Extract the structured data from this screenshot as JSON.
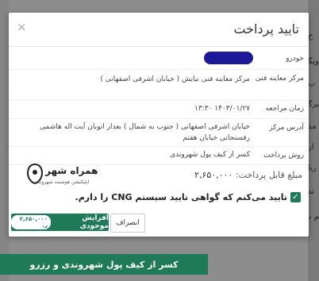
{
  "modal": {
    "title": "تایید پرداخت",
    "close": "×"
  },
  "details": [
    {
      "label": "خودرو",
      "value": ""
    },
    {
      "label": "مرکز معاینه فنی",
      "value": "مرکز معاینه فنی نیایش ( خیابان اشرفی اصفهانی )"
    },
    {
      "label": "زمان مراجعه",
      "value": "۱۴۰۳/۰۱/۲۷ ۱۳:۳۰"
    },
    {
      "label": "آدرس مرکز",
      "value": "خیابان اشرفی اصفهانی ( جنوب به شمال ) بعداز اتوبان آیت اله هاشمی رفسنجانی خیابان هفتم"
    },
    {
      "label": "روش پرداخت",
      "value": "کسر از کیف پول شهروندی"
    }
  ],
  "amount": {
    "label": "مبلغ قابل پرداخت:",
    "value": "۲,۶۵۰,۰۰۰"
  },
  "logo": {
    "name": "همراه شهر",
    "tagline": "اپلیکیشن هوشمند شهروندی"
  },
  "confirm_text": "تایید می‌کنم که گواهی تایید سیستم CNG را دارم.",
  "buttons": {
    "increase_label": "افزایش موجودی",
    "increase_badge": "۲,۶۵۰,۰۰۰ ر.",
    "cancel_label": "انصراف"
  },
  "background": {
    "bottom_button": "کسر از کیف پول شهروندی و رزرو",
    "right_edge_labels": [
      "خ",
      "ویگی",
      "ب",
      "برگ",
      "مد",
      "ار",
      "ریا",
      "ند",
      "م ت"
    ]
  }
}
